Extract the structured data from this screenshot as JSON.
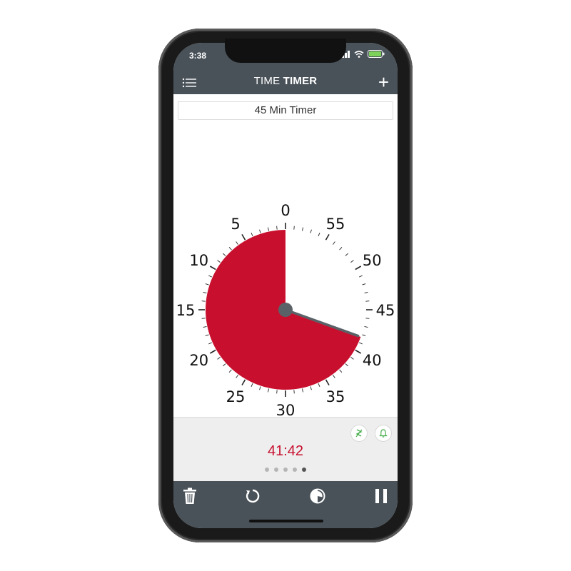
{
  "status_bar": {
    "time": "3:38"
  },
  "nav": {
    "title_light": "TIME",
    "title_bold": "TIMER"
  },
  "timer": {
    "name": "45 Min Timer",
    "remaining": "41:42",
    "remaining_minutes": 41.7,
    "dial_labels": [
      "0",
      "5",
      "10",
      "15",
      "20",
      "25",
      "30",
      "35",
      "40",
      "45",
      "50",
      "55"
    ]
  },
  "page_dots": {
    "count": 5,
    "active_index": 4
  },
  "colors": {
    "accent_red": "#c8102e",
    "bar_gray": "#495259",
    "panel_gray": "#eeeeee",
    "mini_icon_green": "#4caf50"
  },
  "icons": {
    "menu": "list-menu-icon",
    "add": "plus-icon",
    "vibrate": "vibration-icon",
    "alarm": "bell-icon",
    "delete": "trash-icon",
    "reset": "reset-icon",
    "theme": "color-theme-icon",
    "pause": "pause-icon"
  }
}
